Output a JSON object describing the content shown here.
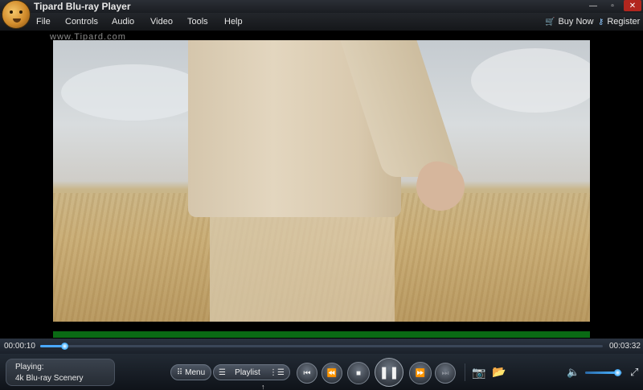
{
  "titlebar": {
    "app_title": "Tipard Blu-ray Player",
    "minimize_glyph": "—",
    "maximize_glyph": "▫",
    "close_glyph": "✕"
  },
  "menubar": {
    "items": [
      "File",
      "Controls",
      "Audio",
      "Video",
      "Tools",
      "Help"
    ],
    "buy_now": "Buy Now",
    "register": "Register"
  },
  "video": {
    "watermark": "www.Tipard.com"
  },
  "seek": {
    "elapsed": "00:00:10",
    "total": "00:03:32",
    "progress": 0.043
  },
  "now_playing": {
    "label": "Playing:",
    "title": "4k Blu-ray Scenery"
  },
  "controls": {
    "menu_label": "Menu",
    "playlist_label": "Playlist"
  },
  "volume": {
    "level": 0.88
  },
  "colors": {
    "accent": "#49b2ff",
    "close_red": "#b2261e",
    "green_bar": "#0a6a14"
  },
  "icons": {
    "app_logo": "cheetah-logo-icon",
    "buy": "cart-icon",
    "register": "key-icon",
    "prev": "previous-chapter-icon",
    "rewind": "rewind-icon",
    "stop": "stop-icon",
    "pause": "pause-icon",
    "forward": "fast-forward-icon",
    "next": "next-chapter-icon",
    "snapshot": "camera-icon",
    "open": "folder-icon",
    "volume": "speaker-icon",
    "fullscreen": "fullscreen-icon"
  }
}
